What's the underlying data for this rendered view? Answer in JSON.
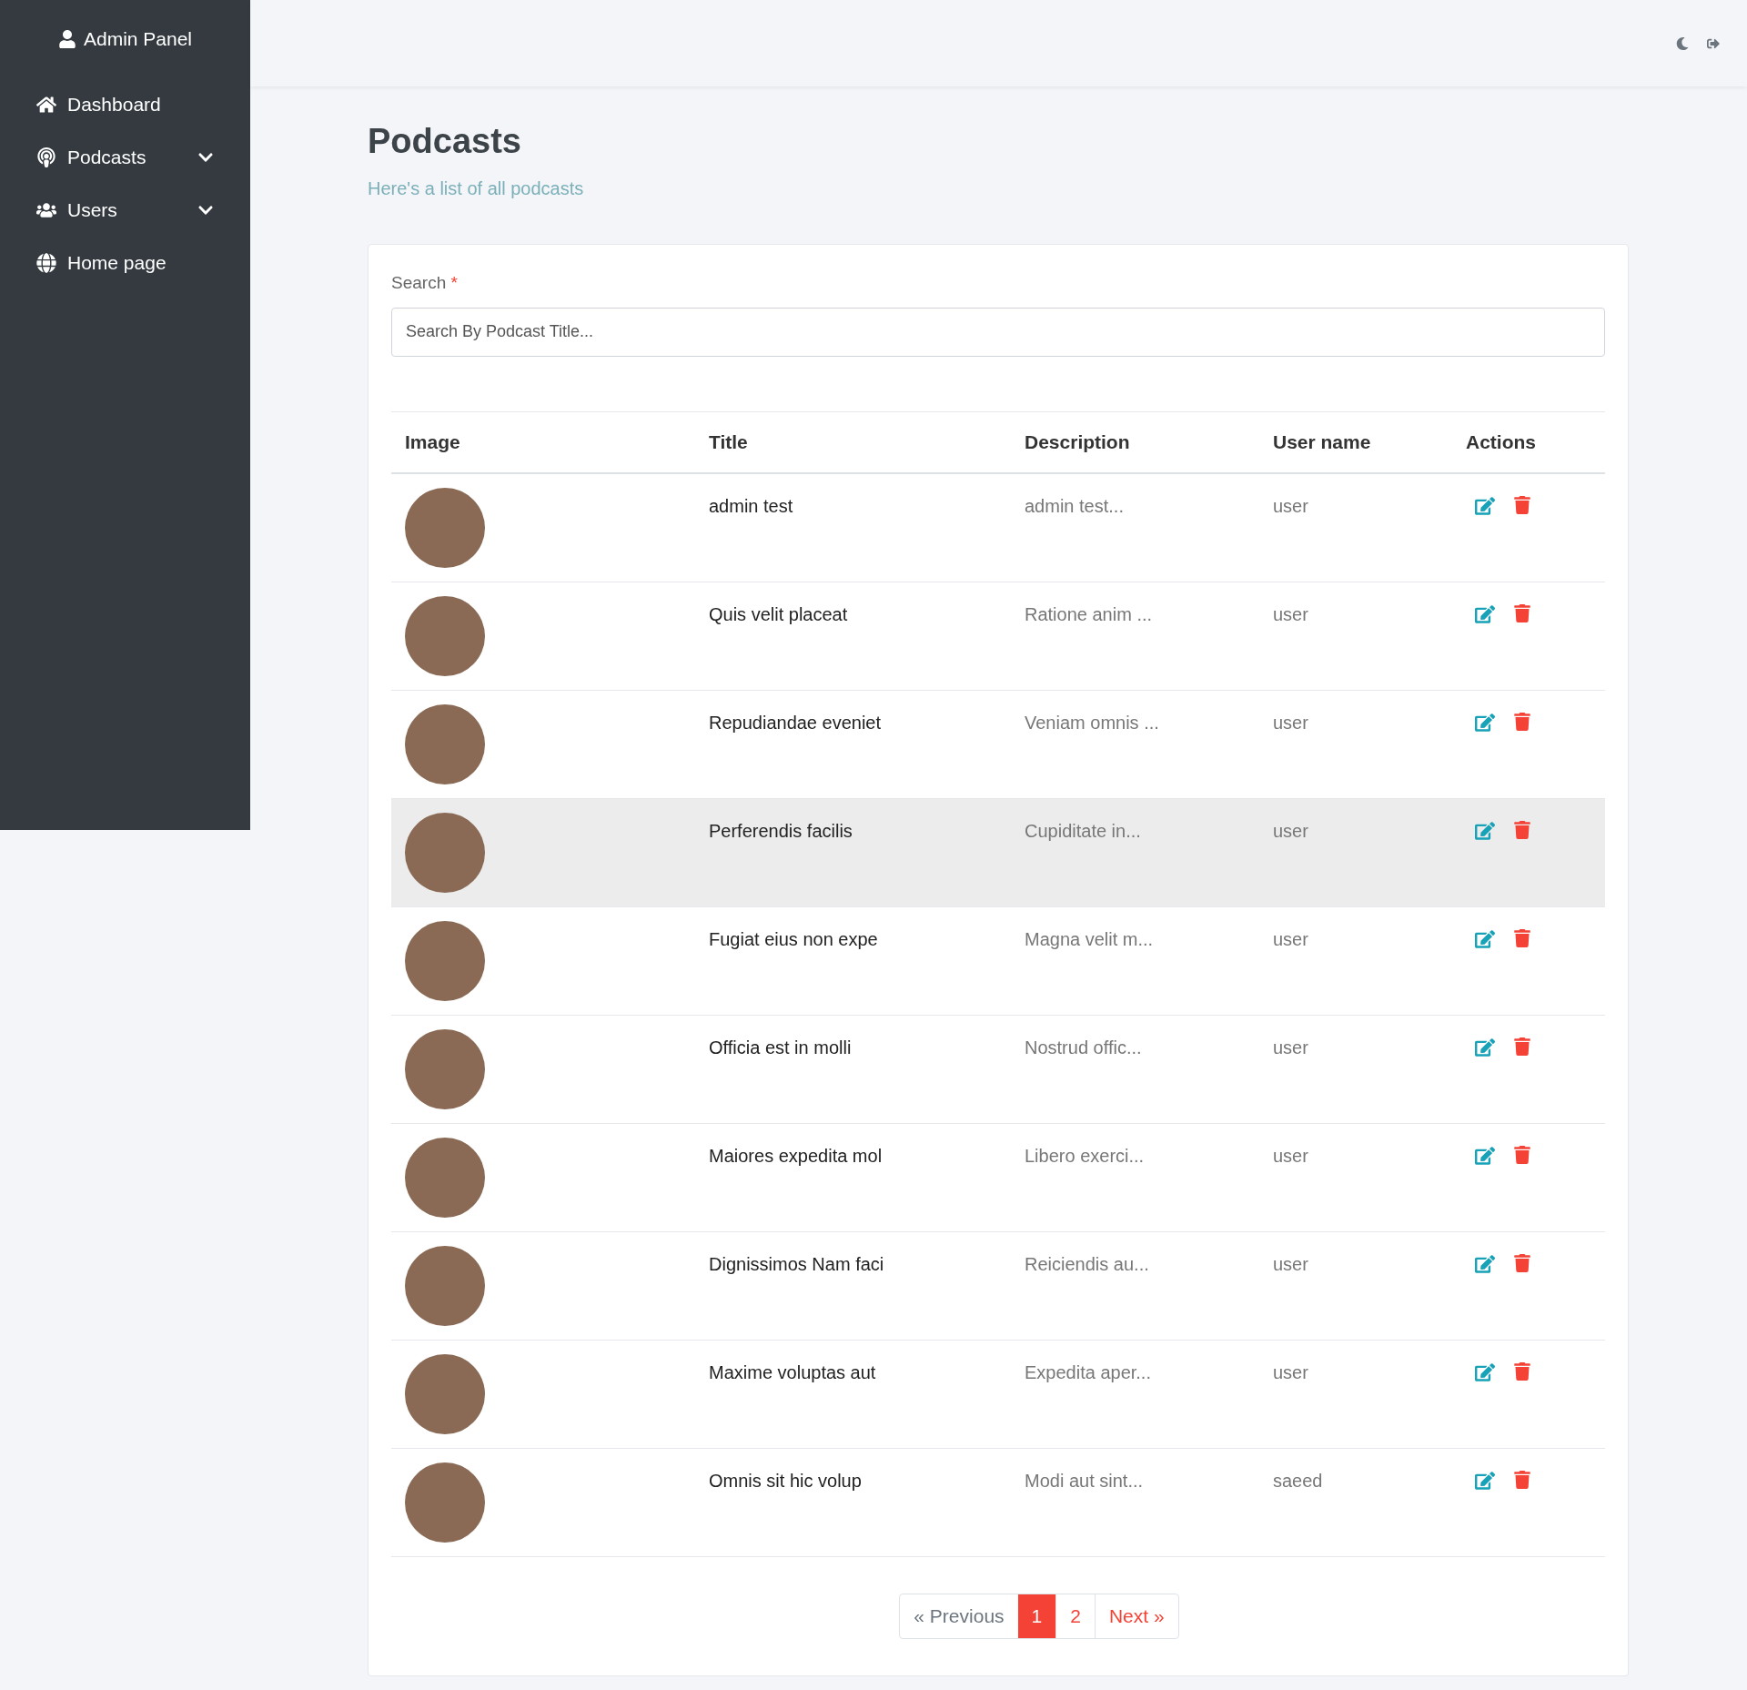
{
  "sidebar": {
    "title": "Admin Panel",
    "items": [
      {
        "label": "Dashboard",
        "kind": "home",
        "expandable": false
      },
      {
        "label": "Podcasts",
        "kind": "podcast",
        "expandable": true
      },
      {
        "label": "Users",
        "kind": "users",
        "expandable": true
      },
      {
        "label": "Home page",
        "kind": "globe",
        "expandable": false
      }
    ]
  },
  "page": {
    "title": "Podcasts",
    "subtitle": "Here's a list of all podcasts"
  },
  "search": {
    "label": "Search",
    "required_mark": "*",
    "placeholder": "Search By Podcast Title..."
  },
  "table": {
    "columns": [
      "Image",
      "Title",
      "Description",
      "User name",
      "Actions"
    ],
    "rows": [
      {
        "title": "admin test",
        "description": "admin test...",
        "user": "user",
        "highlighted": false
      },
      {
        "title": "Quis velit placeat",
        "description": "Ratione anim ...",
        "user": "user",
        "highlighted": false
      },
      {
        "title": "Repudiandae eveniet",
        "description": "Veniam omnis ...",
        "user": "user",
        "highlighted": false
      },
      {
        "title": "Perferendis facilis",
        "description": "Cupiditate in...",
        "user": "user",
        "highlighted": true
      },
      {
        "title": "Fugiat eius non expe",
        "description": "Magna velit m...",
        "user": "user",
        "highlighted": false
      },
      {
        "title": "Officia est in molli",
        "description": "Nostrud offic...",
        "user": "user",
        "highlighted": false
      },
      {
        "title": "Maiores expedita mol",
        "description": "Libero exerci...",
        "user": "user",
        "highlighted": false
      },
      {
        "title": "Dignissimos Nam faci",
        "description": "Reiciendis au...",
        "user": "user",
        "highlighted": false
      },
      {
        "title": "Maxime voluptas aut",
        "description": "Expedita aper...",
        "user": "user",
        "highlighted": false
      },
      {
        "title": "Omnis sit hic volup",
        "description": "Modi aut sint...",
        "user": "saeed",
        "highlighted": false
      }
    ]
  },
  "pagination": {
    "previous": "« Previous",
    "pages": [
      {
        "label": "1",
        "selected": true
      },
      {
        "label": "2",
        "selected": false
      }
    ],
    "next": "Next »"
  }
}
